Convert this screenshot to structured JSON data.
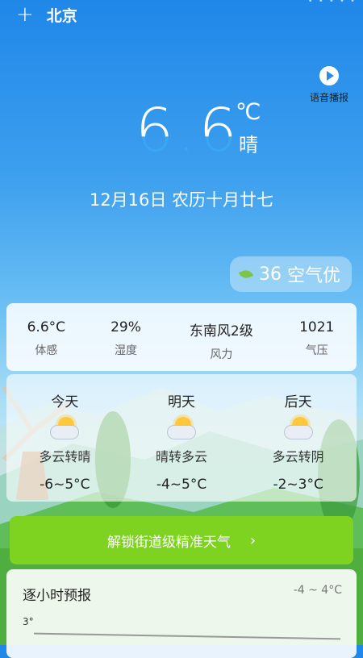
{
  "header": {
    "add_icon": "plus-icon",
    "city": "北京"
  },
  "voice": {
    "label": "语音播报",
    "icon": "play-icon"
  },
  "current": {
    "temperature": "6.6",
    "unit": "℃",
    "condition": "晴"
  },
  "date_line": "12月16日 农历十月廿七",
  "aqi": {
    "value": "36",
    "label": "空气优",
    "icon": "leaf-icon"
  },
  "metrics": [
    {
      "value": "6.6°C",
      "label": "体感"
    },
    {
      "value": "29%",
      "label": "湿度"
    },
    {
      "value": "东南风2级",
      "label": "风力"
    },
    {
      "value": "1021",
      "label": "气压"
    }
  ],
  "forecast": [
    {
      "day": "今天",
      "cond": "多云转晴",
      "range": "-6~5°C",
      "icon": "partly-cloudy-icon"
    },
    {
      "day": "明天",
      "cond": "晴转多云",
      "range": "-4~5°C",
      "icon": "partly-cloudy-icon"
    },
    {
      "day": "后天",
      "cond": "多云转阴",
      "range": "-2~3°C",
      "icon": "partly-cloudy-icon"
    }
  ],
  "unlock": {
    "label": "解锁街道级精准天气",
    "arrow": "›"
  },
  "hourly": {
    "title": "逐小时预报",
    "range": "-4 ~ 4°C",
    "axis_tick": "3°"
  },
  "colors": {
    "sky_top": "#1f87e8",
    "button_green": "#7ed321",
    "leaf": "#7cc44a"
  }
}
